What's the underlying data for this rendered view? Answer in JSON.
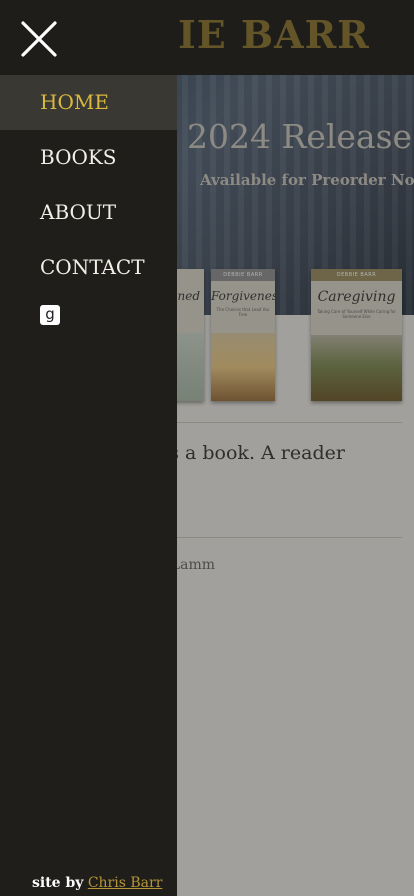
{
  "header": {
    "site_title": "IE BARR"
  },
  "hero": {
    "title": "2024 Releases",
    "subtitle": "Available for Preorder Now"
  },
  "books": [
    {
      "title": "ned",
      "band": ""
    },
    {
      "title": "Forgiveness",
      "band": "DEBBIE BARR",
      "subtitle": "The Choices that Lead You Free"
    },
    {
      "title": "Caregiving",
      "band": "DEBBIE BARR",
      "subtitle": "Taking Care of Yourself While Caring for Someone Else"
    }
  ],
  "quote": {
    "text": "ns a book. A reader",
    "author": "a Lamm"
  },
  "drawer": {
    "close_label": "close",
    "nav": [
      {
        "label": "HOME",
        "active": true
      },
      {
        "label": "BOOKS",
        "active": false
      },
      {
        "label": "ABOUT",
        "active": false
      },
      {
        "label": "CONTACT",
        "active": false
      }
    ],
    "social_icon": "goodreads-icon",
    "social_glyph": "g",
    "credit_prefix": "site by",
    "credit_link": "Chris Barr"
  },
  "colors": {
    "header_bg": "#1f1e1b",
    "brand_gold": "#8a7430",
    "active_nav_text": "#d9b940",
    "active_nav_bg": "#3a3833",
    "link_gold": "#b79638"
  }
}
